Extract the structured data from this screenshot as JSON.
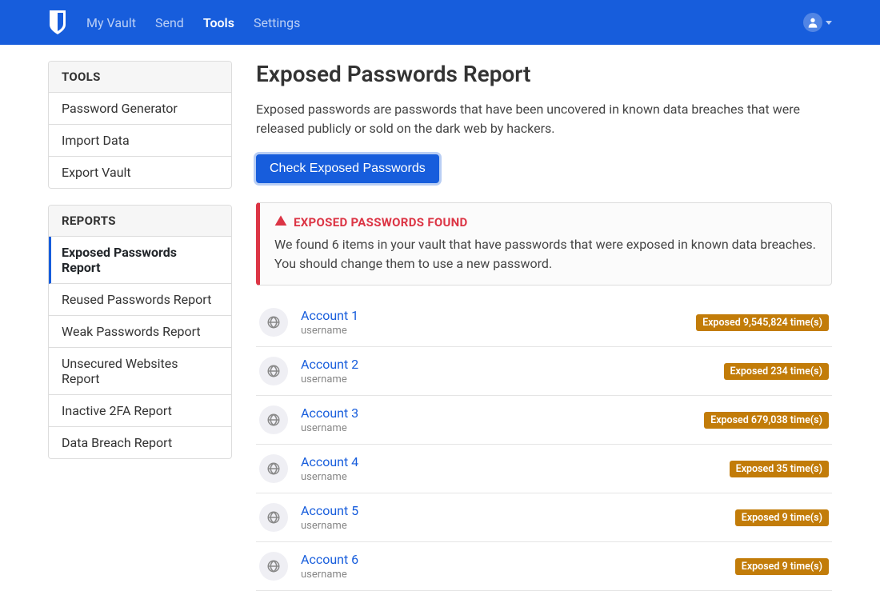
{
  "nav": {
    "items": [
      {
        "label": "My Vault",
        "active": false
      },
      {
        "label": "Send",
        "active": false
      },
      {
        "label": "Tools",
        "active": true
      },
      {
        "label": "Settings",
        "active": false
      }
    ]
  },
  "sidebar": {
    "tools": {
      "header": "TOOLS",
      "items": [
        {
          "label": "Password Generator"
        },
        {
          "label": "Import Data"
        },
        {
          "label": "Export Vault"
        }
      ]
    },
    "reports": {
      "header": "REPORTS",
      "items": [
        {
          "label": "Exposed Passwords Report",
          "active": true
        },
        {
          "label": "Reused Passwords Report"
        },
        {
          "label": "Weak Passwords Report"
        },
        {
          "label": "Unsecured Websites Report"
        },
        {
          "label": "Inactive 2FA Report"
        },
        {
          "label": "Data Breach Report"
        }
      ]
    }
  },
  "page": {
    "title": "Exposed Passwords Report",
    "description": "Exposed passwords are passwords that have been uncovered in known data breaches that were released publicly or sold on the dark web by hackers.",
    "button": "Check Exposed Passwords"
  },
  "alert": {
    "title": "EXPOSED PASSWORDS FOUND",
    "body": "We found 6 items in your vault that have passwords that were exposed in known data breaches. You should change them to use a new password."
  },
  "results": [
    {
      "name": "Account 1",
      "sub": "username",
      "badge": "Exposed 9,545,824 time(s)"
    },
    {
      "name": "Account 2",
      "sub": "username",
      "badge": "Exposed 234 time(s)"
    },
    {
      "name": "Account 3",
      "sub": "username",
      "badge": "Exposed 679,038 time(s)"
    },
    {
      "name": "Account 4",
      "sub": "username",
      "badge": "Exposed 35 time(s)"
    },
    {
      "name": "Account 5",
      "sub": "username",
      "badge": "Exposed 9 time(s)"
    },
    {
      "name": "Account 6",
      "sub": "username",
      "badge": "Exposed 9 time(s)"
    }
  ]
}
